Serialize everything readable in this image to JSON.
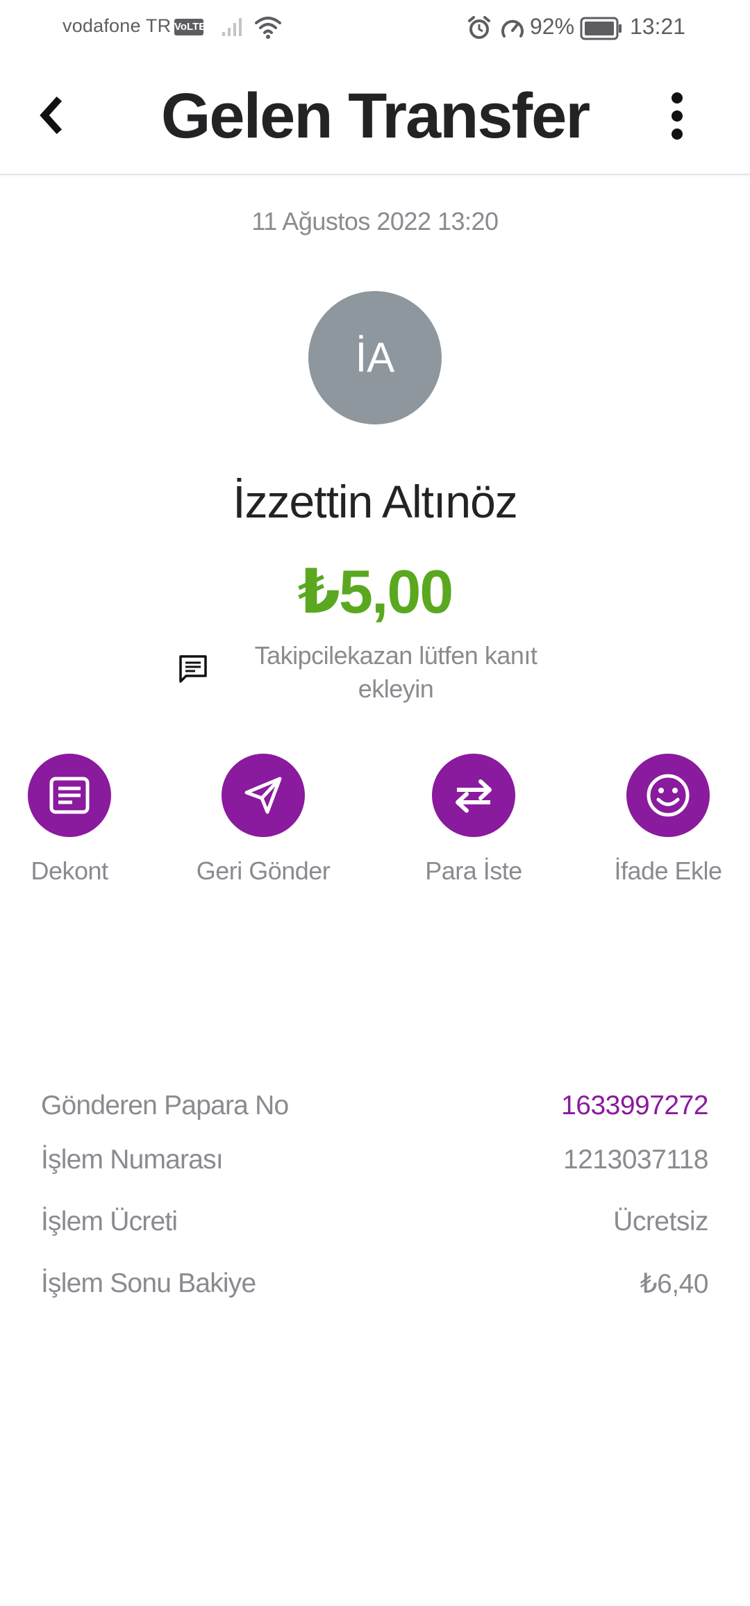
{
  "status_bar": {
    "carrier": "vodafone TR",
    "volte": "VoLTE",
    "battery": "92%",
    "time": "13:21"
  },
  "header": {
    "title": "Gelen Transfer",
    "back_icon": "chevron-left-icon",
    "more_icon": "more-vertical-icon"
  },
  "transaction": {
    "date": "11 Ağustos 2022 13:20",
    "avatar_initials": "İA",
    "sender_name": "İzzettin Altınöz",
    "amount": "₺5,00",
    "amount_color": "#5aa820",
    "note": "Takipcilekazan lütfen kanıt ekleyin"
  },
  "actions": [
    {
      "label": "Dekont",
      "icon": "receipt-icon"
    },
    {
      "label": "Geri Gönder",
      "icon": "send-icon"
    },
    {
      "label": "Para İste",
      "icon": "swap-icon"
    },
    {
      "label": "İfade Ekle",
      "icon": "smile-icon"
    }
  ],
  "details": [
    {
      "label": "Gönderen Papara No",
      "value": "1633997272"
    },
    {
      "label": "İşlem Numarası",
      "value": "1213037118"
    },
    {
      "label": "İşlem Ücreti",
      "value": "Ücretsiz"
    },
    {
      "label": "İşlem Sonu Bakiye",
      "value": "₺6,40"
    }
  ],
  "colors": {
    "accent": "#8a1a9e",
    "avatar_bg": "#8e979e",
    "muted_text": "#8a8a90"
  }
}
